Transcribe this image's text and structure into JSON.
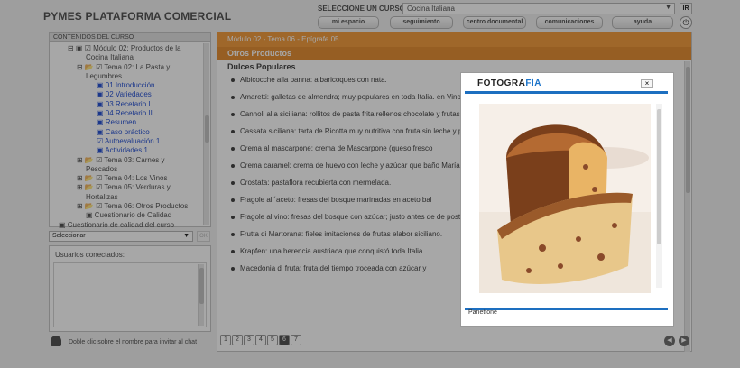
{
  "app": {
    "title": "PYMES PLATAFORMA COMERCIAL",
    "course_label": "SELECCIONE UN CURSO:",
    "course_value": "Cocina Italiana",
    "ir_label": "IR"
  },
  "nav": [
    "mi espacio",
    "seguimiento",
    "centro documental",
    "comunicaciones",
    "ayuda"
  ],
  "sidebar": {
    "title": "CONTENIDOS DEL CURSO",
    "tree": [
      "Módulo 02: Productos de la",
      "Cocina Italiana",
      "Tema 02: La Pasta y",
      "Legumbres",
      "01 Introducción",
      "02 Variedades",
      "03 Recetario I",
      "04 Recetario II",
      "Resumen",
      "Caso práctico",
      "Autoevaluación 1",
      "Actividades 1",
      "Tema 03: Carnes y",
      "Pescados",
      "Tema 04: Los Vinos",
      "Tema 05: Verduras y",
      "Hortalizas",
      "Tema 06: Otros Productos",
      "Cuestionario de Calidad",
      "Cuestionario de calidad del curso"
    ],
    "select": "Seleccionar",
    "ok": "OK"
  },
  "users": {
    "title": "Usuarios conectados:",
    "hint": "Doble clic sobre el nombre para invitar al chat"
  },
  "main": {
    "breadcrumb": "Módulo 02 - Tema 06 - Epígrafe 05",
    "section": "Otros Productos",
    "heading": "Dulces Populares",
    "items": [
      "Albicocche alla panna: albaricoques con nata.",
      "Amaretti: galletas de almendra; muy populares en toda Italia. en Vino Santo o Marsala.",
      "Cannoli alla siciliana: rollitos de pasta frita rellenos chocolate y frutas confitadas.",
      "Cassata siciliana: tarta de Ricotta muy nutritiva con fruta sin leche y pistachos.",
      "Crema al mascarpone: crema de Mascarpone (queso fresco",
      "Crema caramel: crema de huevo con leche y azúcar que baño María y se dejan enfriar para después sacarlos del mo",
      "Crostata: pastaflora recubierta con mermelada.",
      "Fragole all´aceto: fresas del bosque marinadas en aceto bal",
      "Fragole al vino: fresas del bosque con azúcar; justo antes de de postre.",
      "Frutta di Martorana: fieles imitaciones de frutas elabor siciliano.",
      "Krapfen: una herencia austriaca que conquistó toda Italia",
      "Macedonia di fruta: fruta del tiempo troceada con azúcar y"
    ],
    "pages": [
      "1",
      "2",
      "3",
      "4",
      "5",
      "6",
      "7"
    ],
    "current_page": "6"
  },
  "modal": {
    "title_a": "FOTOGRA",
    "title_b": "FÍA",
    "close": "×",
    "caption": "Panettone"
  }
}
